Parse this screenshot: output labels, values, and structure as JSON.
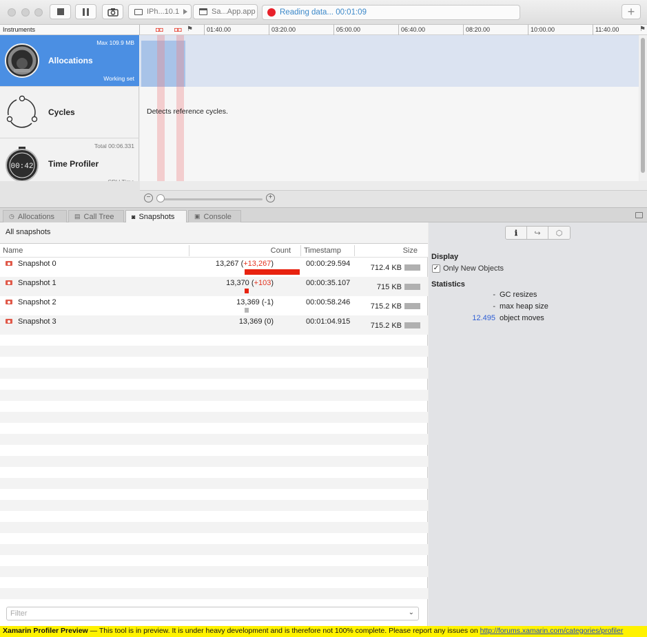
{
  "toolbar": {
    "device": "IPh...10.1",
    "app": "Sa...App.app",
    "status": "Reading data... 00:01:09",
    "add_label": "+"
  },
  "timeline": {
    "header": "Instruments",
    "ticks": [
      "01:40.00",
      "03:20.00",
      "05:00.00",
      "06:40.00",
      "08:20.00",
      "10:00.00",
      "11:40.00"
    ]
  },
  "instruments": [
    {
      "name": "Allocations",
      "top": "Max 109.9 MB",
      "bottom": "Working set",
      "icon": "allocations-gauge-icon"
    },
    {
      "name": "Cycles",
      "top": "",
      "bottom": "",
      "icon": "cycles-icon"
    },
    {
      "name": "Time Profiler",
      "top": "Total 00:06.331",
      "bottom": "CPU Time",
      "icon": "stopwatch-icon"
    }
  ],
  "track": {
    "cycles_desc": "Detects reference cycles.",
    "stopwatch_digits": "00:42"
  },
  "tabs": [
    {
      "label": "Allocations",
      "icon": "clock-icon"
    },
    {
      "label": "Call Tree",
      "icon": "calltree-icon"
    },
    {
      "label": "Snapshots",
      "icon": "camera-icon"
    },
    {
      "label": "Console",
      "icon": "console-icon"
    }
  ],
  "snapshots": {
    "title": "All snapshots",
    "columns": {
      "name": "Name",
      "count": "Count",
      "timestamp": "Timestamp",
      "size": "Size"
    },
    "rows": [
      {
        "name": "Snapshot 0",
        "count": "13,267",
        "delta": "+13,267",
        "delta_color": "#e3321f",
        "ts": "00:00:29.594",
        "size": "712.4 KB",
        "bar": 1.0
      },
      {
        "name": "Snapshot 1",
        "count": "13,370",
        "delta": "+103",
        "delta_color": "#e3321f",
        "ts": "00:00:35.107",
        "size": "715 KB",
        "bar": 0.08
      },
      {
        "name": "Snapshot 2",
        "count": "13,369",
        "delta": "-1",
        "delta_color": "#222222",
        "ts": "00:00:58.246",
        "size": "715.2 KB",
        "bar": 0.08
      },
      {
        "name": "Snapshot 3",
        "count": "13,369",
        "delta": "0",
        "delta_color": "#222222",
        "ts": "00:01:04.915",
        "size": "715.2 KB",
        "bar": 0
      }
    ],
    "filter_placeholder": "Filter"
  },
  "inspector": {
    "display_title": "Display",
    "only_new_label": "Only New Objects",
    "only_new_checked": true,
    "statistics_title": "Statistics",
    "stats": [
      {
        "value": "-",
        "label": "GC resizes"
      },
      {
        "value": "-",
        "label": "max heap size"
      },
      {
        "value": "12.495",
        "label": "object moves"
      }
    ]
  },
  "banner": {
    "title": "Xamarin Profiler Preview",
    "message": " — This tool is in preview. It is under heavy development and is therefore not 100% complete. Please report any issues on ",
    "link": "http://forums.xamarin.com/categories/profiler"
  }
}
